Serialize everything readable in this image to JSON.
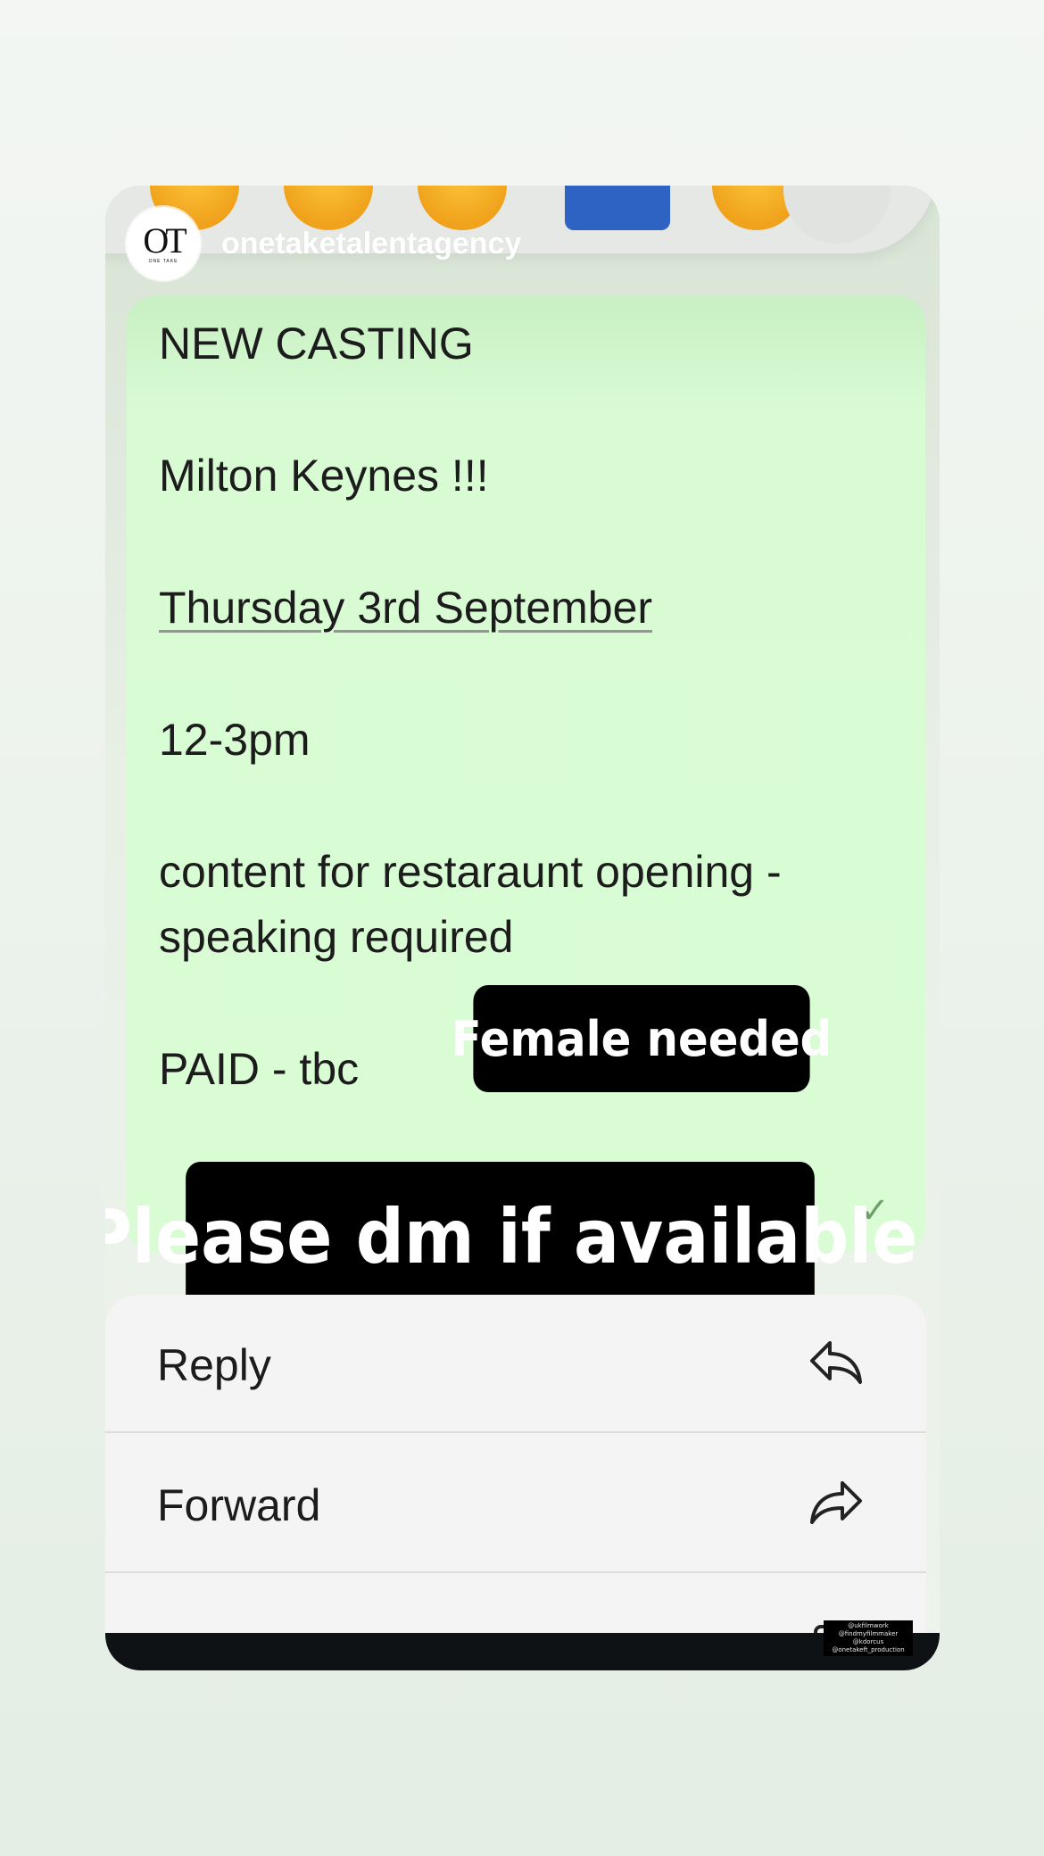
{
  "profile": {
    "username": "onetaketalentagency",
    "logo_mark": "OT",
    "logo_sub": "ONE TAKE"
  },
  "reactions": [
    "grinning-face",
    "smiling-face",
    "crying-face",
    "folded-hands",
    "wink-face"
  ],
  "message": {
    "lines": [
      "NEW CASTING",
      "Milton Keynes !!!",
      "Thursday 3rd September",
      "12-3pm",
      "content for restaraunt opening -",
      "speaking required",
      "PAID - tbc"
    ],
    "status": "✓"
  },
  "stickers": {
    "female": "Female needed",
    "dm": "Please dm if available"
  },
  "menu": {
    "reply": "Reply",
    "forward": "Forward"
  },
  "credits": [
    "@ukfilmwork @findmyfilmmaker",
    "@kdorcus",
    "@onetakeft_production"
  ],
  "colors": {
    "bubble": "#d9fcd4",
    "sticker_bg": "#000000",
    "menu_bg": "#f3f4f3"
  }
}
